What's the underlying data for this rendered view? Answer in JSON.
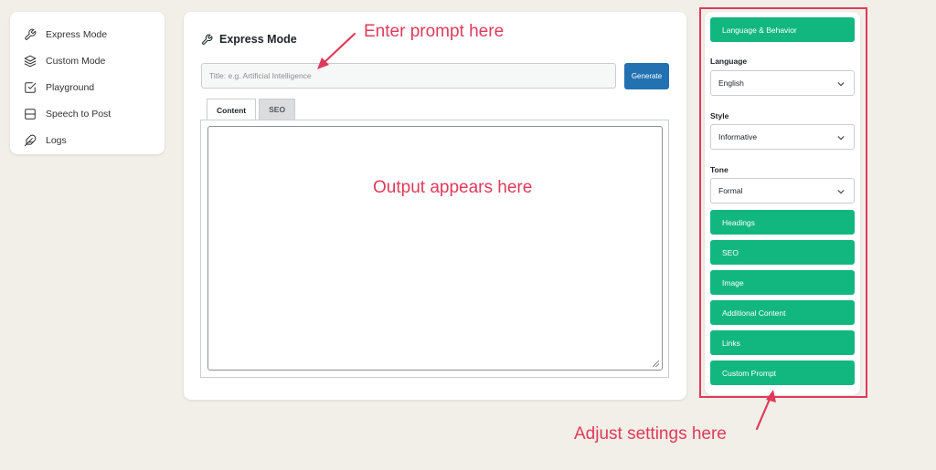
{
  "sidebar": {
    "items": [
      {
        "label": "Express Mode",
        "icon": "wrench-icon"
      },
      {
        "label": "Custom Mode",
        "icon": "layers-icon"
      },
      {
        "label": "Playground",
        "icon": "checkbox-icon"
      },
      {
        "label": "Speech to Post",
        "icon": "panel-icon"
      },
      {
        "label": "Logs",
        "icon": "feather-icon"
      }
    ]
  },
  "main": {
    "title": "Express Mode",
    "title_placeholder": "Title: e.g. Artificial Intelligence",
    "generate_label": "Generate",
    "tabs": [
      {
        "label": "Content"
      },
      {
        "label": "SEO"
      }
    ]
  },
  "settings": {
    "language_behavior_label": "Language & Behavior",
    "language_label": "Language",
    "language_value": "English",
    "style_label": "Style",
    "style_value": "Informative",
    "tone_label": "Tone",
    "tone_value": "Formal",
    "buttons": [
      "Headings",
      "SEO",
      "Image",
      "Additional Content",
      "Links",
      "Custom Prompt"
    ]
  },
  "annotations": {
    "enter_prompt": "Enter prompt here",
    "output_appears": "Output appears here",
    "adjust_settings": "Adjust settings here"
  },
  "colors": {
    "background": "#f2efe8",
    "primary_blue": "#2271b1",
    "green": "#12b77f",
    "annotation_red": "#e03a5a"
  }
}
